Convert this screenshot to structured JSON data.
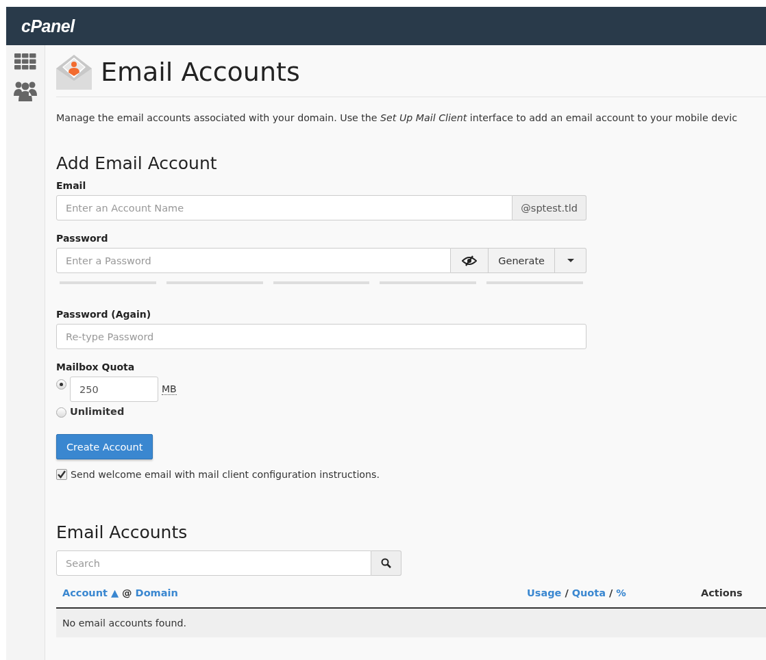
{
  "header": {
    "logo": "cPanel"
  },
  "sidebar": {
    "items": [
      {
        "kind": "grid"
      },
      {
        "kind": "users"
      }
    ]
  },
  "page": {
    "title": "Email Accounts",
    "description": "Manage the email accounts associated with your domain. Use the *Set Up Mail Client* interface to add an email account to your mobile devic"
  },
  "add_form": {
    "heading": "Add Email Account",
    "email": {
      "label": "Email",
      "placeholder": "Enter an Account Name",
      "domain": "@sptest.tld"
    },
    "password": {
      "label": "Password",
      "placeholder": "Enter a Password",
      "generate": "Generate",
      "strength_meter": {
        "level": 0
      }
    },
    "password_again": {
      "label": "Password (Again)",
      "placeholder": "Re-type Password"
    },
    "quota": {
      "label": "Mailbox Quota",
      "options": [
        {
          "kind": "value",
          "value": "250",
          "unit": "MB",
          "selected": true
        },
        {
          "kind": "label",
          "label": "Unlimited",
          "selected": false
        }
      ]
    },
    "submit": "Create Account",
    "welcome_email": {
      "label": "Send welcome email with mail client configuration instructions.",
      "checked": true
    }
  },
  "accounts": {
    "heading": "Email Accounts",
    "search": {
      "placeholder": "Search"
    },
    "columns": [
      {
        "kind": "account",
        "parts": [
          "Account",
          "▲",
          "@",
          "Domain"
        ]
      },
      {
        "kind": "usage",
        "parts": [
          "Usage",
          "/",
          "Quota",
          "/",
          "%"
        ]
      },
      {
        "kind": "actions",
        "parts": [
          "Actions"
        ]
      }
    ],
    "empty_message": "No email accounts found."
  }
}
